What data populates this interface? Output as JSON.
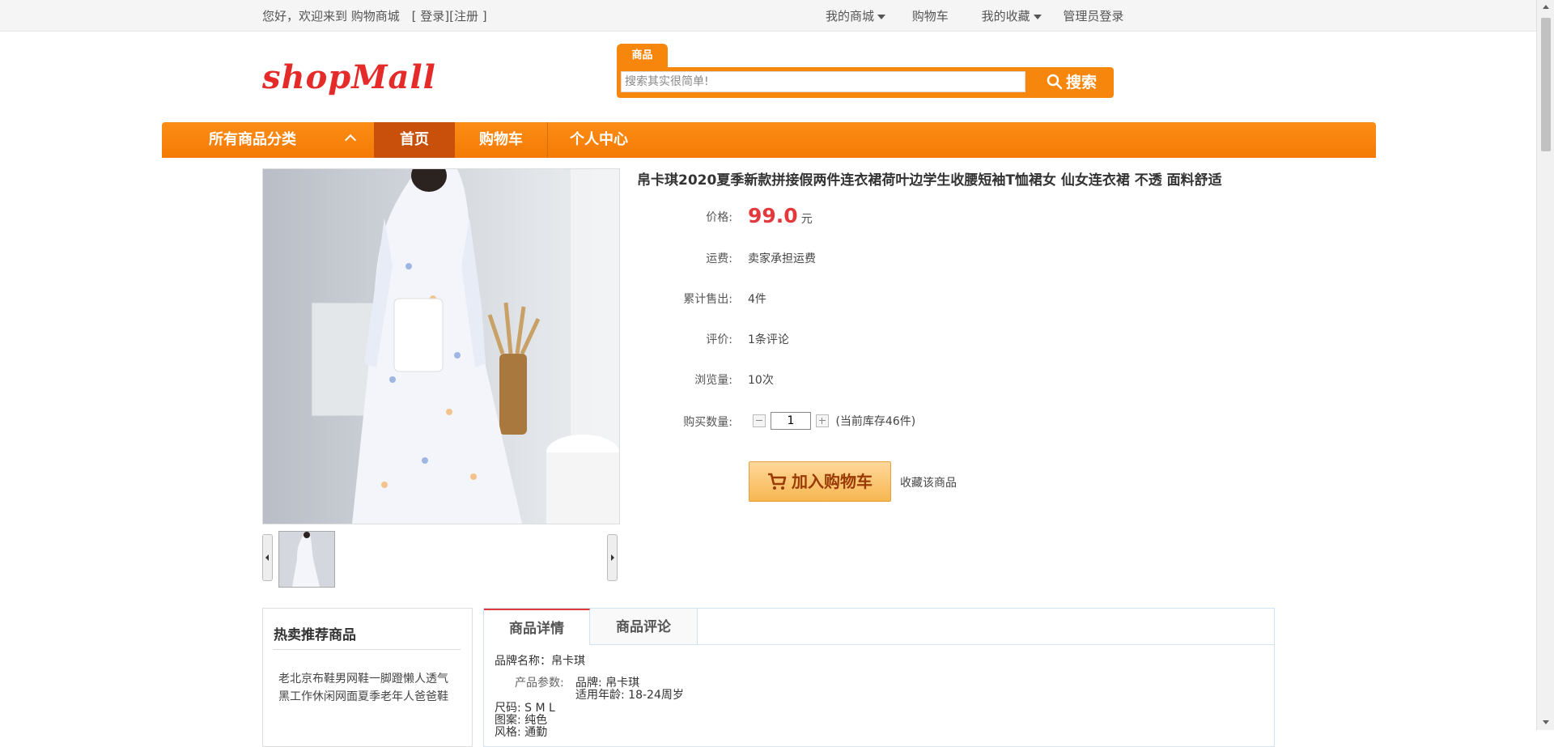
{
  "topbar": {
    "welcome": "您好，欢迎来到 购物商城",
    "login_open": "[",
    "login": "登录",
    "sep": "][",
    "register": "注册",
    "register_close": "]",
    "my_mall": "我的商城",
    "cart": "购物车",
    "my_favorites": "我的收藏",
    "admin_login": "管理员登录"
  },
  "header": {
    "logo": "shopMall",
    "search_tab": "商品",
    "search_placeholder": "搜索其实很简单!",
    "search_button": "搜索"
  },
  "nav": {
    "all_categories": "所有商品分类",
    "home": "首页",
    "cart": "购物车",
    "user_center": "个人中心"
  },
  "product": {
    "title": "帛卡琪2020夏季新款拼接假两件连衣裙荷叶边学生收腰短袖T恤裙女 仙女连衣裙 不透 面料舒适",
    "price_label": "价格:",
    "price": "99.0",
    "price_unit": "元",
    "shipping_label": "运费:",
    "shipping": "卖家承担运费",
    "sold_label": "累计售出:",
    "sold": "4件",
    "reviews_label": "评价:",
    "reviews": "1条评论",
    "views_label": "浏览量:",
    "views": "10次",
    "quantity_label": "购买数量:",
    "quantity": "1",
    "stock": "(当前库存46件)",
    "add_to_cart": "加入购物车",
    "favorite": "收藏该商品"
  },
  "hot": {
    "title": "热卖推荐商品",
    "items": [
      "老北京布鞋男网鞋一脚蹬懒人透气黑工作休闲网面夏季老年人爸爸鞋"
    ]
  },
  "detail": {
    "tabs": [
      "商品详情",
      "商品评论"
    ],
    "brand_line": "品牌名称：帛卡琪",
    "params_label": "产品参数:",
    "param_brand": "品牌: 帛卡琪",
    "param_age": "适用年龄: 18-24周岁",
    "size": "尺码: S M L",
    "pattern": "图案: 纯色",
    "style": "风格: 通勤"
  },
  "colors": {
    "accent": "#f7860d",
    "nav_active": "#c8500a",
    "price": "#e4393c",
    "logo": "#e52a2a"
  }
}
